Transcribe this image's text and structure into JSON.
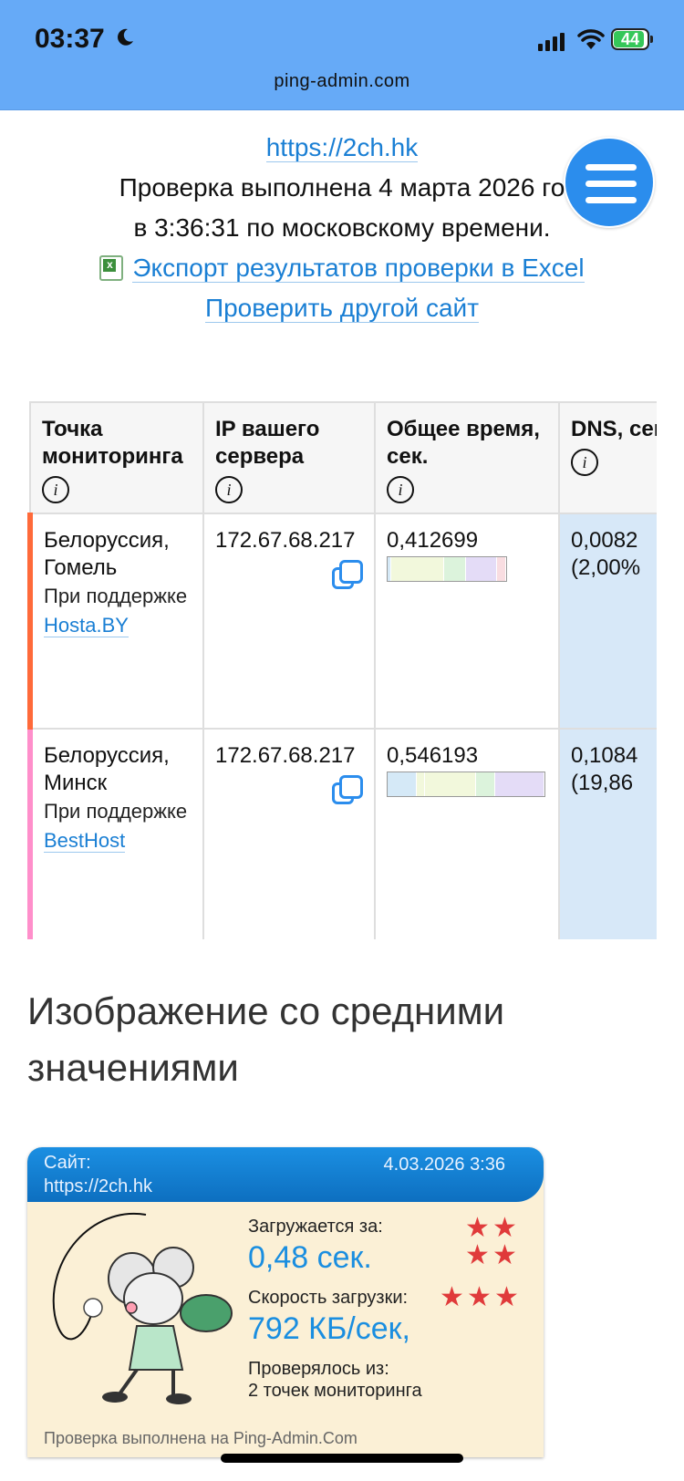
{
  "status_bar": {
    "time": "03:37",
    "battery": "44",
    "domain": "ping-admin.com"
  },
  "site_url": "https://2ch.hk",
  "check_line1": "Проверка выполнена 4 марта 2026 го",
  "check_line2": "в 3:36:31 по московскому времени.",
  "export_link": "Экспорт результатов проверки в Excel",
  "check_other_link": "Проверить другой сайт",
  "table": {
    "headers": [
      "Точка мониторинга",
      "IP вашего сервера",
      "Общее время, сек.",
      "DNS, сек."
    ],
    "rows": [
      {
        "location": "Белоруссия, Гомель",
        "sponsor_prefix": "При поддержке",
        "sponsor_link": "Hosta.BY",
        "ip": "172.67.68.217",
        "total": "0,412699",
        "dns": "0,0082",
        "dns_pct": "(2,00%",
        "accent_color": "#ff6a3a",
        "bar_segments": [
          {
            "color": "#d5e9f7",
            "share": 0.02
          },
          {
            "color": "#f2f8dc",
            "share": 0.46
          },
          {
            "color": "#dcf3dc",
            "share": 0.18
          },
          {
            "color": "#e4dcf7",
            "share": 0.27
          },
          {
            "color": "#f9dde1",
            "share": 0.07
          }
        ]
      },
      {
        "location": "Белоруссия, Минск",
        "sponsor_prefix": "При поддержке",
        "sponsor_link": "BestHost",
        "ip": "172.67.68.217",
        "total": "0,546193",
        "dns": "0,1084",
        "dns_pct": "(19,86",
        "accent_color": "#ff8fcb",
        "bar_segments": [
          {
            "color": "#d5e9f7",
            "share": 0.2
          },
          {
            "color": "#f2f8dc",
            "share": 0.05
          },
          {
            "color": "#f2f8dc",
            "share": 0.36
          },
          {
            "color": "#dcf3dc",
            "share": 0.13
          },
          {
            "color": "#e4dcf7",
            "share": 0.34
          }
        ]
      }
    ]
  },
  "section_heading": "Изображение со средними значениями",
  "card": {
    "site_label": "Сайт:",
    "site": "https://2ch.hk",
    "date": "4.03.2026 3:36",
    "load_label": "Загружается за:",
    "load_value": "0,48 сек.",
    "speed_label": "Скорость загрузки:",
    "speed_value": "792 КБ/сек,",
    "checked_from_label": "Проверялось из:",
    "checked_from_value": "2 точек мониторинга",
    "footer": "Проверка выполнена на Ping-Admin.Com"
  },
  "colors": {
    "status_bar": "#66aaf7",
    "link": "#1a7fd4",
    "menu_button": "#2b8ded"
  }
}
